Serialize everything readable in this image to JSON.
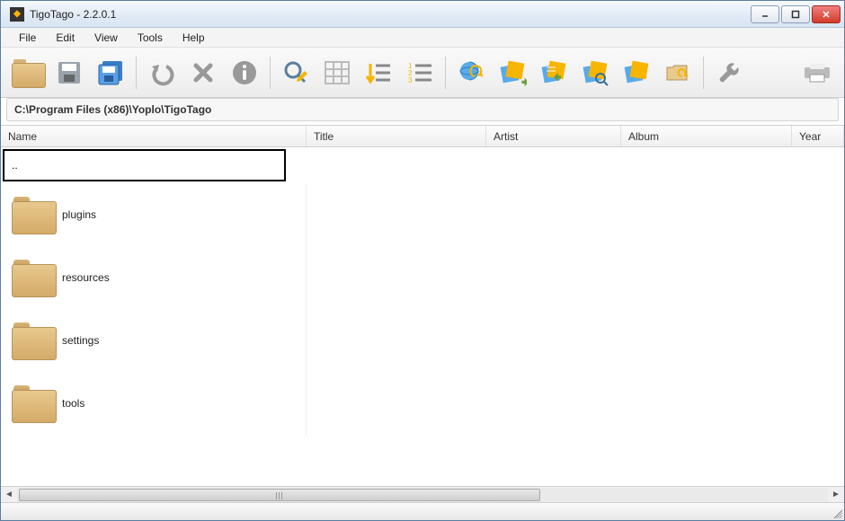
{
  "window": {
    "title": "TigoTago - 2.2.0.1"
  },
  "menubar": {
    "items": [
      "File",
      "Edit",
      "View",
      "Tools",
      "Help"
    ]
  },
  "toolbar": {
    "icons": [
      "open-folder",
      "save",
      "save-all",
      "undo",
      "delete",
      "info",
      "search-edit",
      "table",
      "sort",
      "numbered-list",
      "web-refresh",
      "tag-export",
      "tag-import",
      "tag-search",
      "tag-sync",
      "tag-folder",
      "wrench",
      "print"
    ]
  },
  "path": "C:\\Program Files (x86)\\Yoplo\\TigoTago",
  "columns": {
    "name": "Name",
    "title": "Title",
    "artist": "Artist",
    "album": "Album",
    "year": "Year"
  },
  "rows": [
    {
      "label": "..",
      "type": "up",
      "selected": true
    },
    {
      "label": "plugins",
      "type": "folder"
    },
    {
      "label": "resources",
      "type": "folder"
    },
    {
      "label": "settings",
      "type": "folder"
    },
    {
      "label": "tools",
      "type": "folder"
    }
  ]
}
